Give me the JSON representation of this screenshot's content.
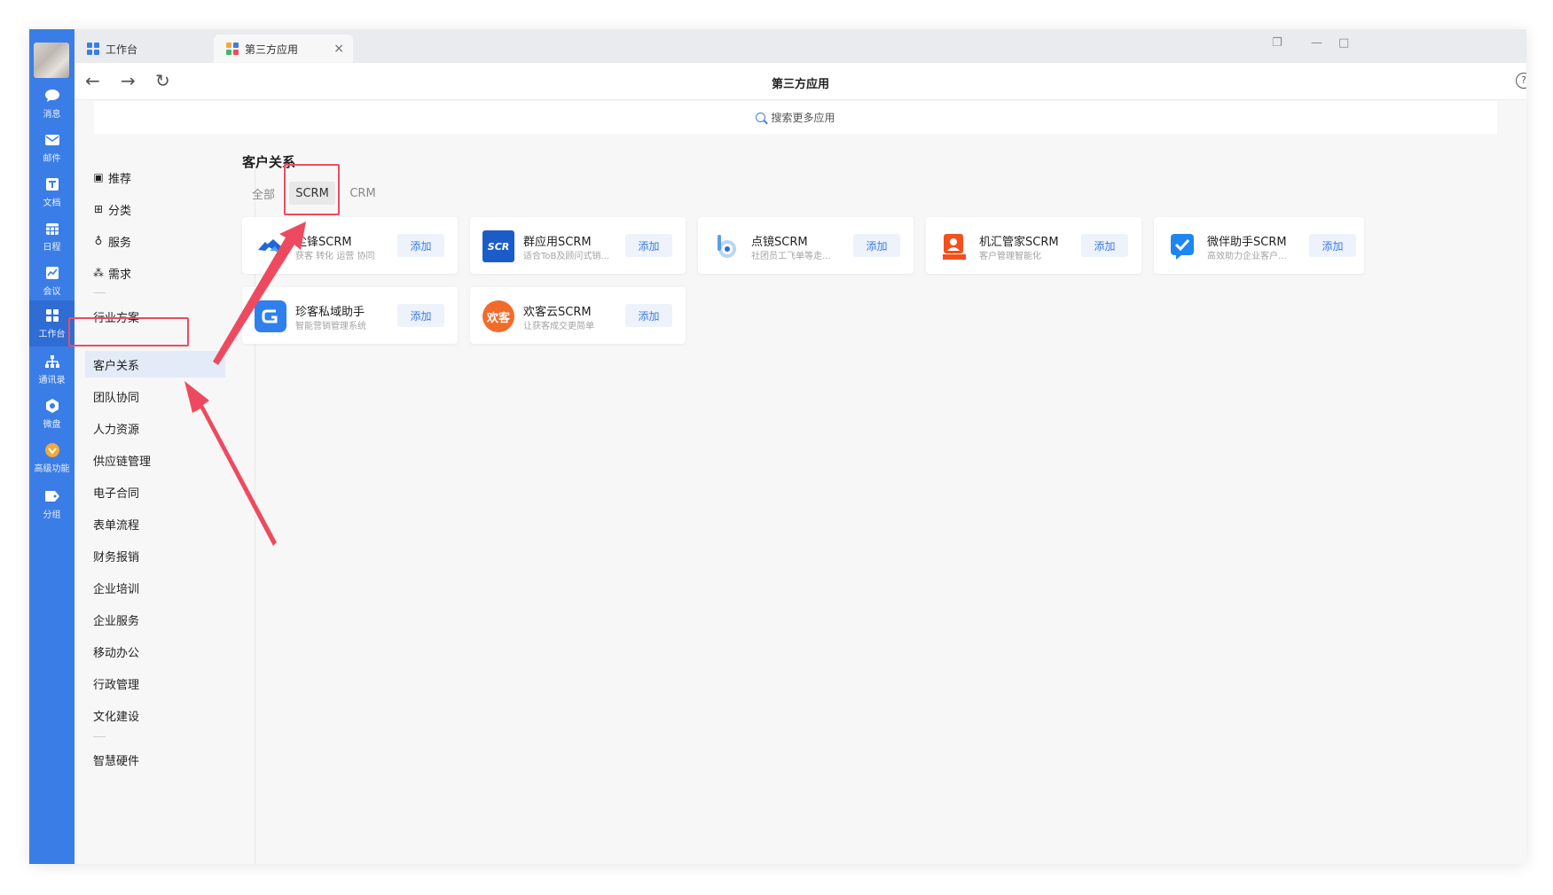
{
  "tabs": [
    {
      "label": "工作台",
      "active": false
    },
    {
      "label": "第三方应用",
      "active": true
    }
  ],
  "window": {
    "close_tab": "×",
    "minimize": "—",
    "restore": "❐",
    "maximize": "□"
  },
  "nav": {
    "back": "←",
    "forward": "→",
    "reload": "↻",
    "title": "第三方应用",
    "help": "?"
  },
  "search": {
    "placeholder": "搜索更多应用"
  },
  "rail": {
    "items": [
      {
        "label": "消息",
        "icon": "chat-icon"
      },
      {
        "label": "邮件",
        "icon": "mail-icon"
      },
      {
        "label": "文档",
        "icon": "doc-icon"
      },
      {
        "label": "日程",
        "icon": "calendar-icon"
      },
      {
        "label": "会议",
        "icon": "meeting-icon"
      },
      {
        "label": "工作台",
        "icon": "grid-icon",
        "active": true
      },
      {
        "label": "通讯录",
        "icon": "contacts-icon"
      },
      {
        "label": "微盘",
        "icon": "drive-icon"
      },
      {
        "label": "高级功能",
        "icon": "advanced-icon"
      },
      {
        "label": "分组",
        "icon": "tag-icon"
      }
    ]
  },
  "sidebar": {
    "top_items": [
      {
        "label": "推荐",
        "icon": "recommend-icon"
      },
      {
        "label": "分类",
        "icon": "category-icon"
      },
      {
        "label": "服务",
        "icon": "service-icon"
      },
      {
        "label": "需求",
        "icon": "demand-icon"
      }
    ],
    "categories": [
      "行业方案",
      "客户关系",
      "团队协同",
      "人力资源",
      "供应链管理",
      "电子合同",
      "表单流程",
      "财务报销",
      "企业培训",
      "企业服务",
      "移动办公",
      "行政管理",
      "文化建设"
    ],
    "bottom_items": [
      "智慧硬件"
    ],
    "active_category": "客户关系"
  },
  "content": {
    "section_title": "客户关系",
    "filters": [
      "全部",
      "SCRM",
      "CRM"
    ],
    "active_filter": "SCRM",
    "add_label": "添加",
    "apps": [
      {
        "name": "尘锋SCRM",
        "desc": "获客 转化 运营 协同",
        "logo_text": "",
        "color": "#ffffff"
      },
      {
        "name": "群应用SCRM",
        "desc": "适合ToB及顾问式销...",
        "logo_text": "SCR",
        "color": "#1b5cc9"
      },
      {
        "name": "点镜SCRM",
        "desc": "社团员工飞单等走...",
        "logo_text": "b",
        "color": "#ffffff"
      },
      {
        "name": "机汇管家SCRM",
        "desc": "客户管理智能化",
        "logo_text": "",
        "color": "#ffffff"
      },
      {
        "name": "微伴助手SCRM",
        "desc": "高效助力企业客户...",
        "logo_text": "",
        "color": "#ffffff"
      },
      {
        "name": "珍客私域助手",
        "desc": "智能营销管理系统",
        "logo_text": "",
        "color": "#2f80ed"
      },
      {
        "name": "欢客云SCRM",
        "desc": "让获客成交更简单",
        "logo_text": "欢客",
        "color": "#f26b2a"
      }
    ]
  },
  "colors": {
    "accent": "#3b7de6",
    "annotation": "#ee4a5f"
  }
}
